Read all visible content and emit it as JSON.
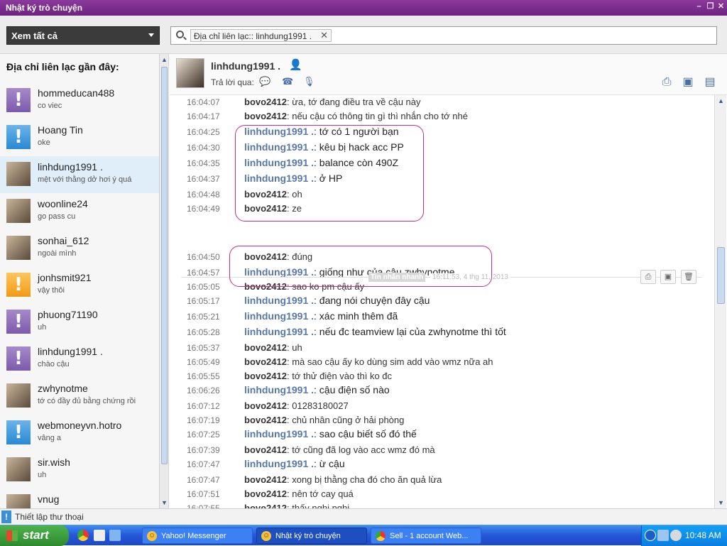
{
  "window": {
    "title": "Nhật ký trò chuyện"
  },
  "view_select": {
    "value": "Xem tất cả"
  },
  "search": {
    "chip": "Địa chỉ liên lạc:: linhdung1991 ."
  },
  "sidebar": {
    "header": "Địa chỉ liên lạc gần đây:",
    "contacts": [
      {
        "name": "hommeducan488",
        "status": "co viec",
        "avatar": "exclamation-purple"
      },
      {
        "name": "Hoang Tin",
        "status": "oke",
        "avatar": "exclamation-blue"
      },
      {
        "name": "linhdung1991 .",
        "status": "mệt với thằng dở hơi ý quá",
        "avatar": "photo"
      },
      {
        "name": "woonline24",
        "status": "go pass cu",
        "avatar": "photo"
      },
      {
        "name": "sonhai_612",
        "status": "ngoài mình",
        "avatar": "photo"
      },
      {
        "name": "jonhsmit921",
        "status": "vậy thôi",
        "avatar": "exclamation-orange"
      },
      {
        "name": "phuong71190",
        "status": "uh",
        "avatar": "exclamation-purple"
      },
      {
        "name": "linhdung1991 .",
        "status": "chào cậu",
        "avatar": "exclamation-purple"
      },
      {
        "name": "zwhynotme",
        "status": "tớ có đầy đủ bằng chứng rồi",
        "avatar": "photo"
      },
      {
        "name": "webmoneyvn.hotro",
        "status": "vâng a",
        "avatar": "exclamation-blue"
      },
      {
        "name": "sir.wish",
        "status": "uh",
        "avatar": "photo"
      },
      {
        "name": "vnug",
        "status": "",
        "avatar": "photo"
      }
    ]
  },
  "chat": {
    "contact_name": "linhdung1991 .",
    "reply_label": "Trả lời qua:",
    "separator_label": "Tin nhắn nhanh",
    "separator_time": "16:11:53, 4 thg 11, 2013",
    "messages": [
      {
        "time": "16:04:07",
        "sender": "bovo2412",
        "text": ": ừa, tớ đang điều tra về cậu này",
        "me": true
      },
      {
        "time": "16:04:17",
        "sender": "bovo2412",
        "text": ": nếu cậu có thông tin gì thì nhắn cho tớ nhé",
        "me": true
      },
      {
        "time": "16:04:25",
        "sender": "linhdung1991 .",
        "text": ": tớ có 1 người bạn",
        "me": false
      },
      {
        "time": "16:04:30",
        "sender": "linhdung1991 .",
        "text": ": kêu bị hack acc PP",
        "me": false
      },
      {
        "time": "16:04:35",
        "sender": "linhdung1991 .",
        "text": ": balance còn 490Z",
        "me": false
      },
      {
        "time": "16:04:37",
        "sender": "linhdung1991 .",
        "text": ": ở HP",
        "me": false
      },
      {
        "time": "16:04:48",
        "sender": "bovo2412",
        "text": ": oh",
        "me": true
      },
      {
        "time": "16:04:49",
        "sender": "bovo2412",
        "text": ": ze",
        "me": true
      },
      {
        "time": "16:04:50",
        "sender": "bovo2412",
        "text": ": đúng",
        "me": true
      },
      {
        "time": "16:04:57",
        "sender": "linhdung1991 .",
        "text": ": giống như của cậu zwhynotme",
        "me": false
      },
      {
        "time": "16:05:05",
        "sender": "bovo2412",
        "text": ": sao ko pm cậu ấy",
        "me": true
      },
      {
        "time": "16:05:17",
        "sender": "linhdung1991 .",
        "text": ": đang nói chuyện đây cậu",
        "me": false
      },
      {
        "time": "16:05:21",
        "sender": "linhdung1991 .",
        "text": ": xác minh thêm đã",
        "me": false
      },
      {
        "time": "16:05:28",
        "sender": "linhdung1991 .",
        "text": ": nếu đc teamview lại của zwhynotme thì tốt",
        "me": false
      },
      {
        "time": "16:05:37",
        "sender": "bovo2412",
        "text": ": uh",
        "me": true
      },
      {
        "time": "16:05:49",
        "sender": "bovo2412",
        "text": ": mà sao cậu ấy ko dùng sim add vào wmz nữa ah",
        "me": true
      },
      {
        "time": "16:05:55",
        "sender": "bovo2412",
        "text": ": tớ thử điện vào thì ko đc",
        "me": true
      },
      {
        "time": "16:06:26",
        "sender": "linhdung1991 .",
        "text": ": cậu điện số nào",
        "me": false
      },
      {
        "time": "16:07:12",
        "sender": "bovo2412",
        "text": ": 01283180027",
        "me": true
      },
      {
        "time": "16:07:19",
        "sender": "bovo2412",
        "text": ": chủ nhân cũng ở hải phòng",
        "me": true
      },
      {
        "time": "16:07:25",
        "sender": "linhdung1991 .",
        "text": ": sao cậu biết số đó thế",
        "me": false
      },
      {
        "time": "16:07:39",
        "sender": "bovo2412",
        "text": ": tớ cũng đã log vào acc wmz đó mà",
        "me": true
      },
      {
        "time": "16:07:47",
        "sender": "linhdung1991 .",
        "text": ": ừ cậu",
        "me": false
      },
      {
        "time": "16:07:47",
        "sender": "bovo2412",
        "text": ": xong bị thằng cha đó cho ăn quả lừa",
        "me": true
      },
      {
        "time": "16:07:51",
        "sender": "bovo2412",
        "text": ": nên tớ cay quá",
        "me": true
      },
      {
        "time": "16:07:55",
        "sender": "bovo2412",
        "text": ": thấy nghi nghi",
        "me": true
      }
    ]
  },
  "phone_bar": {
    "label": "Thiết lập thư thoại"
  },
  "taskbar": {
    "start": "start",
    "tasks": [
      "Yahoo! Messenger",
      "Nhật ký trò chuyện",
      "Sell - 1 account Web..."
    ],
    "clock": "10:48 AM"
  }
}
